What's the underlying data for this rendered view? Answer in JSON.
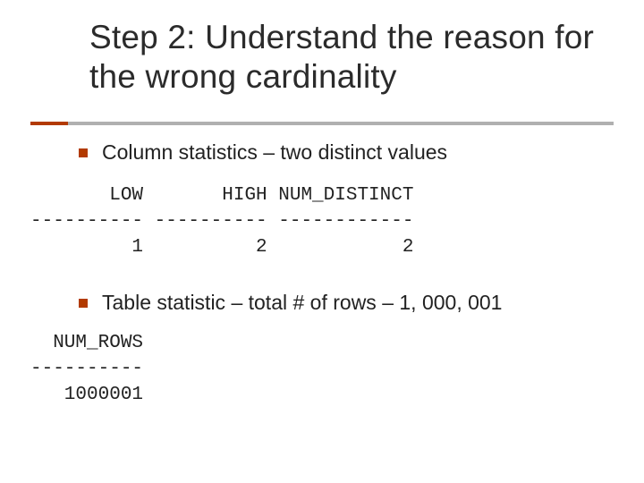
{
  "title": "Step 2: Understand the reason for the wrong cardinality",
  "bullets": [
    "Column statistics – two distinct values",
    "Table statistic – total # of rows – 1, 000, 001"
  ],
  "column_stats_block": "       LOW       HIGH NUM_DISTINCT\n---------- ---------- ------------\n         1          2            2",
  "table_stat_block": "  NUM_ROWS\n----------\n   1000001",
  "chart_data": {
    "type": "table",
    "tables": [
      {
        "name": "column_statistics",
        "columns": [
          "LOW",
          "HIGH",
          "NUM_DISTINCT"
        ],
        "rows": [
          [
            1,
            2,
            2
          ]
        ]
      },
      {
        "name": "table_statistic",
        "columns": [
          "NUM_ROWS"
        ],
        "rows": [
          [
            1000001
          ]
        ]
      }
    ]
  }
}
